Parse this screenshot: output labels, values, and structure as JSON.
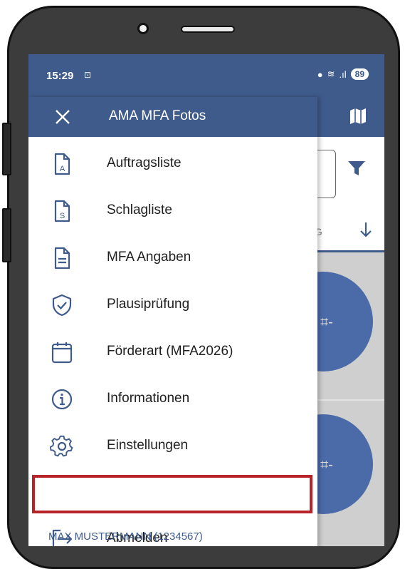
{
  "status_bar": {
    "time": "15:29",
    "battery": "89"
  },
  "drawer": {
    "title": "AMA MFA Fotos",
    "items": [
      {
        "label": "Auftragsliste",
        "icon": "document-a-icon"
      },
      {
        "label": "Schlagliste",
        "icon": "document-s-icon"
      },
      {
        "label": "MFA Angaben",
        "icon": "document-lines-icon"
      },
      {
        "label": "Plausiprüfung",
        "icon": "shield-check-icon"
      },
      {
        "label": "Förderart (MFA2026)",
        "icon": "calendar-icon"
      },
      {
        "label": "Informationen",
        "icon": "info-icon"
      },
      {
        "label": "Einstellungen",
        "icon": "gear-icon"
      },
      {
        "label": "Abmelden",
        "icon": "logout-icon"
      }
    ],
    "user": "MAX MUSTERMANN (1234567)"
  },
  "background": {
    "sort_fragment": "IG"
  },
  "colors": {
    "primary": "#3f5b8c",
    "highlight": "#b8232a"
  }
}
